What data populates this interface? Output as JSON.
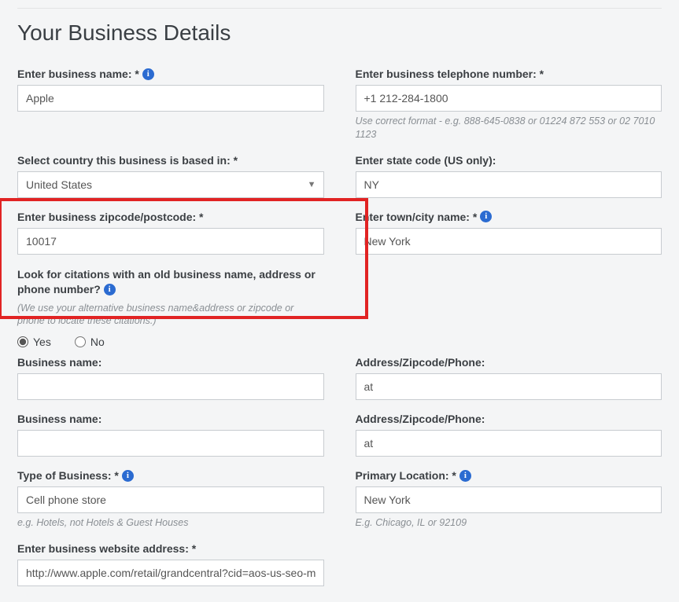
{
  "title": "Your Business Details",
  "left": {
    "name": {
      "label": "Enter business name: *",
      "value": "Apple"
    },
    "country": {
      "label": "Select country this business is based in: *",
      "value": "United States"
    },
    "zip": {
      "label": "Enter business zipcode/postcode: *",
      "value": "10017"
    },
    "citations": {
      "label": "Look for citations with an old business name, address or phone number?",
      "hint": "(We use your alternative business name&address or zipcode or phone to locate these citations.)",
      "yes": "Yes",
      "no": "No"
    },
    "alt_name1": {
      "label": "Business name:",
      "value": ""
    },
    "alt_name2": {
      "label": "Business name:",
      "value": ""
    },
    "type": {
      "label": "Type of Business: *",
      "value": "Cell phone store",
      "hint": "e.g. Hotels, not Hotels & Guest Houses"
    },
    "website": {
      "label": "Enter business website address: *",
      "value": "http://www.apple.com/retail/grandcentral?cid=aos-us-seo-maps"
    }
  },
  "right": {
    "phone": {
      "label": "Enter business telephone number: *",
      "value": "+1 212-284-1800",
      "hint": "Use correct format - e.g. 888-645-0838 or 01224 872 553 or 02 7010 1123"
    },
    "state": {
      "label": "Enter state code (US only):",
      "value": "NY"
    },
    "city": {
      "label": "Enter town/city name: *",
      "value": "New York"
    },
    "addr1": {
      "label": "Address/Zipcode/Phone:",
      "value": "at"
    },
    "addr2": {
      "label": "Address/Zipcode/Phone:",
      "value": "at"
    },
    "primary": {
      "label": "Primary Location: *",
      "value": "New York",
      "hint": "E.g. Chicago, IL or 92109"
    }
  }
}
